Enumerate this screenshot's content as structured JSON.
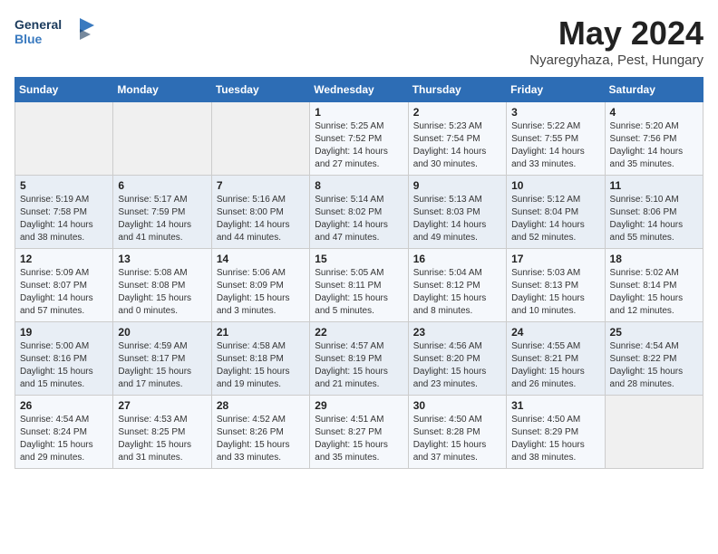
{
  "header": {
    "logo_line1": "General",
    "logo_line2": "Blue",
    "month_year": "May 2024",
    "location": "Nyaregyhaza, Pest, Hungary"
  },
  "calendar": {
    "weekdays": [
      "Sunday",
      "Monday",
      "Tuesday",
      "Wednesday",
      "Thursday",
      "Friday",
      "Saturday"
    ],
    "weeks": [
      [
        {
          "day": "",
          "info": ""
        },
        {
          "day": "",
          "info": ""
        },
        {
          "day": "",
          "info": ""
        },
        {
          "day": "1",
          "info": "Sunrise: 5:25 AM\nSunset: 7:52 PM\nDaylight: 14 hours\nand 27 minutes."
        },
        {
          "day": "2",
          "info": "Sunrise: 5:23 AM\nSunset: 7:54 PM\nDaylight: 14 hours\nand 30 minutes."
        },
        {
          "day": "3",
          "info": "Sunrise: 5:22 AM\nSunset: 7:55 PM\nDaylight: 14 hours\nand 33 minutes."
        },
        {
          "day": "4",
          "info": "Sunrise: 5:20 AM\nSunset: 7:56 PM\nDaylight: 14 hours\nand 35 minutes."
        }
      ],
      [
        {
          "day": "5",
          "info": "Sunrise: 5:19 AM\nSunset: 7:58 PM\nDaylight: 14 hours\nand 38 minutes."
        },
        {
          "day": "6",
          "info": "Sunrise: 5:17 AM\nSunset: 7:59 PM\nDaylight: 14 hours\nand 41 minutes."
        },
        {
          "day": "7",
          "info": "Sunrise: 5:16 AM\nSunset: 8:00 PM\nDaylight: 14 hours\nand 44 minutes."
        },
        {
          "day": "8",
          "info": "Sunrise: 5:14 AM\nSunset: 8:02 PM\nDaylight: 14 hours\nand 47 minutes."
        },
        {
          "day": "9",
          "info": "Sunrise: 5:13 AM\nSunset: 8:03 PM\nDaylight: 14 hours\nand 49 minutes."
        },
        {
          "day": "10",
          "info": "Sunrise: 5:12 AM\nSunset: 8:04 PM\nDaylight: 14 hours\nand 52 minutes."
        },
        {
          "day": "11",
          "info": "Sunrise: 5:10 AM\nSunset: 8:06 PM\nDaylight: 14 hours\nand 55 minutes."
        }
      ],
      [
        {
          "day": "12",
          "info": "Sunrise: 5:09 AM\nSunset: 8:07 PM\nDaylight: 14 hours\nand 57 minutes."
        },
        {
          "day": "13",
          "info": "Sunrise: 5:08 AM\nSunset: 8:08 PM\nDaylight: 15 hours\nand 0 minutes."
        },
        {
          "day": "14",
          "info": "Sunrise: 5:06 AM\nSunset: 8:09 PM\nDaylight: 15 hours\nand 3 minutes."
        },
        {
          "day": "15",
          "info": "Sunrise: 5:05 AM\nSunset: 8:11 PM\nDaylight: 15 hours\nand 5 minutes."
        },
        {
          "day": "16",
          "info": "Sunrise: 5:04 AM\nSunset: 8:12 PM\nDaylight: 15 hours\nand 8 minutes."
        },
        {
          "day": "17",
          "info": "Sunrise: 5:03 AM\nSunset: 8:13 PM\nDaylight: 15 hours\nand 10 minutes."
        },
        {
          "day": "18",
          "info": "Sunrise: 5:02 AM\nSunset: 8:14 PM\nDaylight: 15 hours\nand 12 minutes."
        }
      ],
      [
        {
          "day": "19",
          "info": "Sunrise: 5:00 AM\nSunset: 8:16 PM\nDaylight: 15 hours\nand 15 minutes."
        },
        {
          "day": "20",
          "info": "Sunrise: 4:59 AM\nSunset: 8:17 PM\nDaylight: 15 hours\nand 17 minutes."
        },
        {
          "day": "21",
          "info": "Sunrise: 4:58 AM\nSunset: 8:18 PM\nDaylight: 15 hours\nand 19 minutes."
        },
        {
          "day": "22",
          "info": "Sunrise: 4:57 AM\nSunset: 8:19 PM\nDaylight: 15 hours\nand 21 minutes."
        },
        {
          "day": "23",
          "info": "Sunrise: 4:56 AM\nSunset: 8:20 PM\nDaylight: 15 hours\nand 23 minutes."
        },
        {
          "day": "24",
          "info": "Sunrise: 4:55 AM\nSunset: 8:21 PM\nDaylight: 15 hours\nand 26 minutes."
        },
        {
          "day": "25",
          "info": "Sunrise: 4:54 AM\nSunset: 8:22 PM\nDaylight: 15 hours\nand 28 minutes."
        }
      ],
      [
        {
          "day": "26",
          "info": "Sunrise: 4:54 AM\nSunset: 8:24 PM\nDaylight: 15 hours\nand 29 minutes."
        },
        {
          "day": "27",
          "info": "Sunrise: 4:53 AM\nSunset: 8:25 PM\nDaylight: 15 hours\nand 31 minutes."
        },
        {
          "day": "28",
          "info": "Sunrise: 4:52 AM\nSunset: 8:26 PM\nDaylight: 15 hours\nand 33 minutes."
        },
        {
          "day": "29",
          "info": "Sunrise: 4:51 AM\nSunset: 8:27 PM\nDaylight: 15 hours\nand 35 minutes."
        },
        {
          "day": "30",
          "info": "Sunrise: 4:50 AM\nSunset: 8:28 PM\nDaylight: 15 hours\nand 37 minutes."
        },
        {
          "day": "31",
          "info": "Sunrise: 4:50 AM\nSunset: 8:29 PM\nDaylight: 15 hours\nand 38 minutes."
        },
        {
          "day": "",
          "info": ""
        }
      ]
    ]
  }
}
